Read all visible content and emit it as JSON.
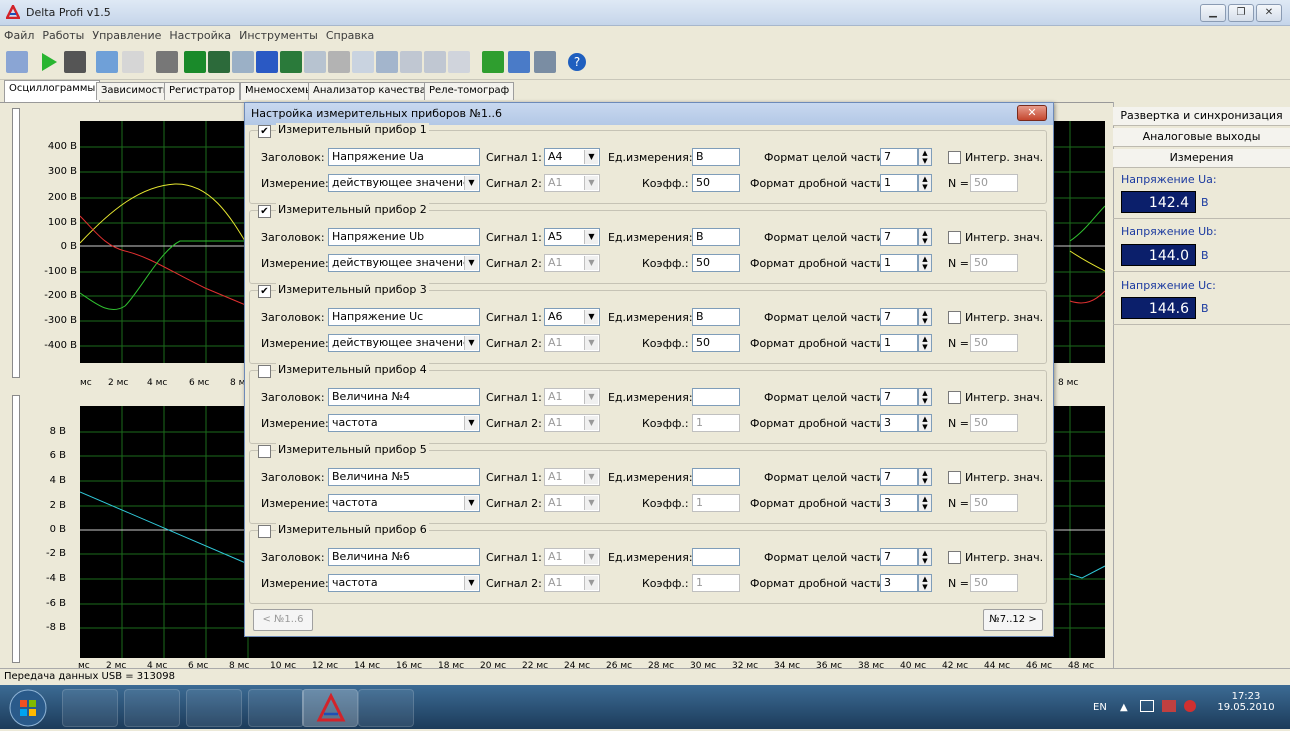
{
  "window": {
    "title": "Delta Profi v1.5"
  },
  "menu": [
    "Файл",
    "Работы",
    "Управление",
    "Настройка",
    "Инструменты",
    "Справка"
  ],
  "tabs": [
    "Осциллограммы",
    "Зависимости",
    "Регистратор",
    "Мнемосхемы",
    "Анализатор качества",
    "Реле-томограф"
  ],
  "plot1": {
    "y_labels": [
      "400 В",
      "300 В",
      "200 В",
      "100 В",
      "0 В",
      "-100 В",
      "-200 В",
      "-300 В",
      "-400 В"
    ],
    "x_labels": [
      "мс",
      "2 мс",
      "4 мс",
      "6 мс",
      "8 м"
    ],
    "x_label_right": "8 мс"
  },
  "plot2": {
    "y_labels": [
      "8 В",
      "6 В",
      "4 В",
      "2 В",
      "0 В",
      "-2 В",
      "-4 В",
      "-6 В",
      "-8 В"
    ],
    "x_labels": [
      "мс",
      "2 мс",
      "4 мс",
      "6 мс",
      "8 мс",
      "10 мс",
      "12 мс",
      "14 мс",
      "16 мс",
      "18 мс",
      "20 мс",
      "22 мс",
      "24 мс",
      "26 мс",
      "28 мс",
      "30 мс",
      "32 мс",
      "34 мс",
      "36 мс",
      "38 мс",
      "40 мс",
      "42 мс",
      "44 мс",
      "46 мс",
      "48 мс"
    ]
  },
  "right_panel": {
    "buttons": [
      "Развертка и синхронизация",
      "Аналоговые выходы",
      "Измерения"
    ],
    "measurements": [
      {
        "label": "Напряжение Ua:",
        "value": "142.4",
        "unit": "В"
      },
      {
        "label": "Напряжение Ub:",
        "value": "144.0",
        "unit": "В"
      },
      {
        "label": "Напряжение Uc:",
        "value": "144.6",
        "unit": "В"
      }
    ]
  },
  "dialog": {
    "title": "Настройка измерительных приборов №1..6",
    "labels": {
      "header": "Заголовок:",
      "measure": "Измерение:",
      "signal1": "Сигнал 1:",
      "signal2": "Сигнал 2:",
      "unit": "Ед.измерения:",
      "coef": "Коэфф.:",
      "int_fmt": "Формат целой части:",
      "frac_fmt": "Формат дробной части:",
      "integr": "Интегр. знач.",
      "n": "N ="
    },
    "devices": [
      {
        "title": "Измерительный прибор 1",
        "checked": "✔",
        "header": "Напряжение Ua",
        "measure": "действующее значение",
        "signal1": "A4",
        "signal2": "A1",
        "unit": "В",
        "coef": "50",
        "int_fmt": "7",
        "frac_fmt": "1",
        "n": "50"
      },
      {
        "title": "Измерительный прибор 2",
        "checked": "✔",
        "header": "Напряжение Ub",
        "measure": "действующее значение",
        "signal1": "A5",
        "signal2": "A1",
        "unit": "В",
        "coef": "50",
        "int_fmt": "7",
        "frac_fmt": "1",
        "n": "50"
      },
      {
        "title": "Измерительный прибор 3",
        "checked": "✔",
        "header": "Напряжение Uc",
        "measure": "действующее значение",
        "signal1": "A6",
        "signal2": "A1",
        "unit": "В",
        "coef": "50",
        "int_fmt": "7",
        "frac_fmt": "1",
        "n": "50"
      },
      {
        "title": "Измерительный прибор 4",
        "checked": "",
        "header": "Величина №4",
        "measure": "частота",
        "signal1": "A1",
        "signal2": "A1",
        "unit": "",
        "coef": "1",
        "int_fmt": "7",
        "frac_fmt": "3",
        "n": "50"
      },
      {
        "title": "Измерительный прибор 5",
        "checked": "",
        "header": "Величина №5",
        "measure": "частота",
        "signal1": "A1",
        "signal2": "A1",
        "unit": "",
        "coef": "1",
        "int_fmt": "7",
        "frac_fmt": "3",
        "n": "50"
      },
      {
        "title": "Измерительный прибор 6",
        "checked": "",
        "header": "Величина №6",
        "measure": "частота",
        "signal1": "A1",
        "signal2": "A1",
        "unit": "",
        "coef": "1",
        "int_fmt": "7",
        "frac_fmt": "3",
        "n": "50"
      }
    ],
    "prev_button": "< №1..6",
    "next_button": "№7..12 >"
  },
  "status": {
    "text": "Передача данных USB = 313098"
  },
  "taskbar": {
    "lang": "EN",
    "time": "17:23",
    "date": "19.05.2010"
  }
}
